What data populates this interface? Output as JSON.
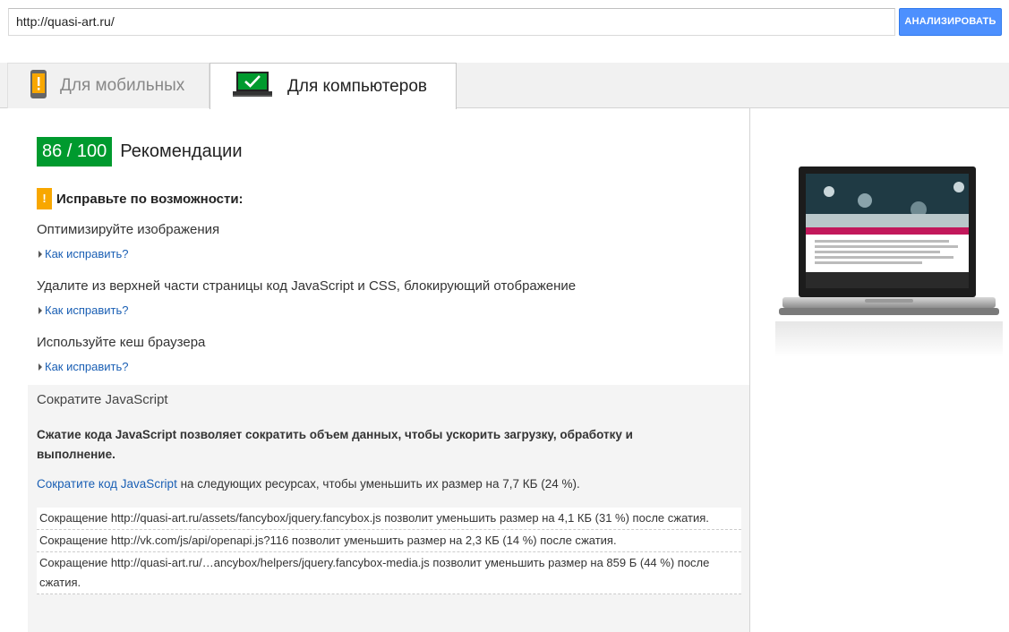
{
  "url_input": {
    "value": "http://quasi-art.ru/"
  },
  "analyze_button": {
    "label": "АНАЛИЗИРОВАТЬ"
  },
  "tabs": [
    {
      "label": "Для мобильных",
      "icon": "phone-warning-icon",
      "active": false
    },
    {
      "label": "Для компьютеров",
      "icon": "laptop-check-icon",
      "active": true
    }
  ],
  "score": {
    "value": "86 / 100",
    "title": "Рекомендации",
    "color": "#009a2e"
  },
  "fix_section": {
    "icon": "warning-icon",
    "icon_text": "!",
    "title": "Исправьте по возможности:",
    "color": "#f8a700"
  },
  "rules": [
    {
      "title": "Оптимизируйте изображения",
      "link": "Как исправить?"
    },
    {
      "title": "Удалите из верхней части страницы код JavaScript и CSS, блокирующий отображение",
      "link": "Как исправить?"
    },
    {
      "title": "Используйте кеш браузера",
      "link": "Как исправить?"
    }
  ],
  "expanded_rule": {
    "title": "Сократите JavaScript",
    "description": "Сжатие кода JavaScript позволяет сократить объем данных, чтобы ускорить загрузку, обработку и выполнение.",
    "summary_link": "Сократите код JavaScript",
    "summary_rest": " на следующих ресурсах, чтобы уменьшить их размер на 7,7 КБ (24 %).",
    "resources": [
      "Сокращение http://quasi-art.ru/assets/fancybox/jquery.fancybox.js позволит уменьшить размер на 4,1 КБ (31 %) после сжатия.",
      "Сокращение http://vk.com/js/api/openapi.js?116 позволит уменьшить размер на 2,3 КБ (14 %) после сжатия.",
      "Сокращение http://quasi-art.ru/…ancybox/helpers/jquery.fancybox-media.js позволит уменьшить размер на 859 Б (44 %) после сжатия."
    ]
  },
  "preview": {
    "icon": "laptop-screenshot-preview"
  }
}
